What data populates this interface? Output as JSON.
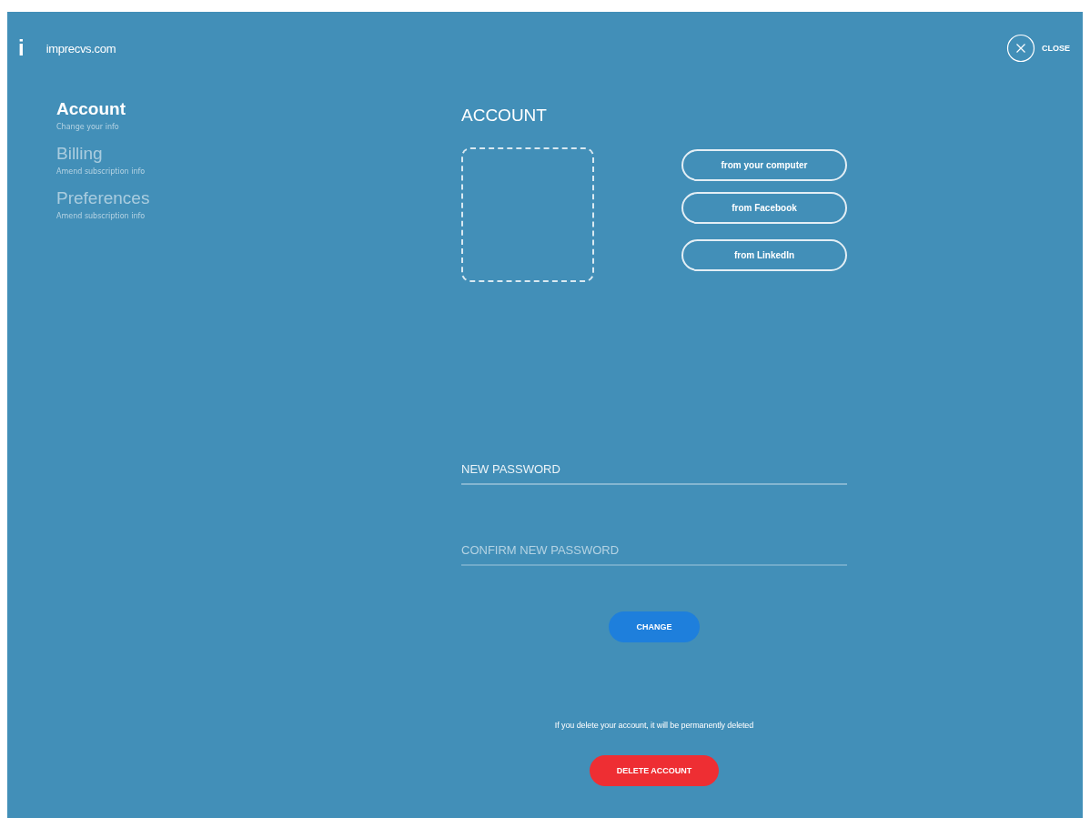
{
  "brand": {
    "logo": "i",
    "name": "imprecvs.com"
  },
  "close": {
    "label": "CLOSE"
  },
  "sidebar": {
    "items": [
      {
        "title": "Account",
        "subtitle": "Change your info",
        "selected": true
      },
      {
        "title": "Billing",
        "subtitle": "Amend subscription info",
        "selected": false
      },
      {
        "title": "Preferences",
        "subtitle": "Amend subscription info",
        "selected": false
      }
    ]
  },
  "main": {
    "title": "ACCOUNT",
    "photo_sources": [
      "from your computer",
      "from Facebook",
      "from LinkedIn"
    ],
    "fields": [
      {
        "placeholder": "NEW PASSWORD",
        "focused": true
      },
      {
        "placeholder": "CONFIRM NEW PASSWORD",
        "focused": false
      }
    ],
    "change_button": "CHANGE",
    "delete_notice": "If you delete your account, it will be permanently deleted",
    "delete_button": "DELETE ACCOUNT"
  }
}
